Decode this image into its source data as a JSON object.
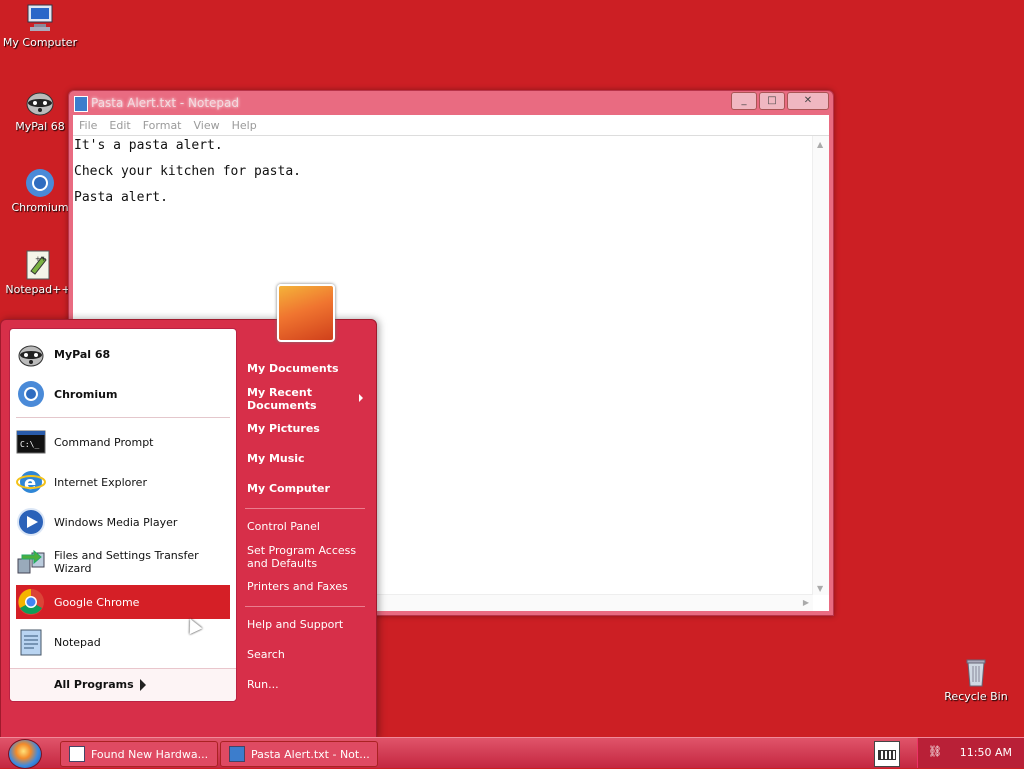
{
  "desktop": {
    "icons": [
      {
        "label": "My Computer",
        "icon": "computer-icon"
      },
      {
        "label": "MyPal 68",
        "icon": "raccoon-icon"
      },
      {
        "label": "Chromium",
        "icon": "chromium-icon"
      },
      {
        "label": "Notepad++",
        "icon": "notepadpp-icon"
      },
      {
        "label": "Recycle Bin",
        "icon": "recycle-bin-icon"
      }
    ]
  },
  "notepad": {
    "title": "Pasta Alert.txt - Notepad",
    "menu": [
      "File",
      "Edit",
      "Format",
      "View",
      "Help"
    ],
    "lines": [
      "It's a pasta alert.",
      "Check your kitchen for pasta.",
      "Pasta alert."
    ],
    "buttons": {
      "minimize": "_",
      "maximize": "□",
      "close": "✕"
    }
  },
  "startmenu": {
    "pinned": [
      {
        "label": "MyPal 68",
        "icon": "raccoon-icon"
      },
      {
        "label": "Chromium",
        "icon": "chromium-icon"
      }
    ],
    "recent": [
      {
        "label": "Command Prompt",
        "icon": "cmd-icon"
      },
      {
        "label": "Internet Explorer",
        "icon": "ie-icon"
      },
      {
        "label": "Windows Media Player",
        "icon": "wmp-icon"
      },
      {
        "label": "Files and Settings Transfer Wizard",
        "icon": "transfer-wizard-icon"
      },
      {
        "label": "Google Chrome",
        "icon": "chrome-icon"
      },
      {
        "label": "Notepad",
        "icon": "notepad-icon"
      }
    ],
    "all_programs": "All Programs",
    "right": {
      "group1": [
        "My Documents",
        "My Recent Documents",
        "My Pictures",
        "My Music",
        "My Computer"
      ],
      "group2": [
        "Control Panel",
        "Set Program Access and Defaults",
        "Printers and Faxes"
      ],
      "group3": [
        "Help and Support",
        "Search",
        "Run..."
      ]
    }
  },
  "taskbar": {
    "tasks": [
      "Found New Hardwa...",
      "Pasta Alert.txt - Not..."
    ],
    "clock": "11:50 AM"
  },
  "colors": {
    "desktop": "#cc1f24",
    "accent": "#d72f49",
    "selected": "#d51f26"
  }
}
